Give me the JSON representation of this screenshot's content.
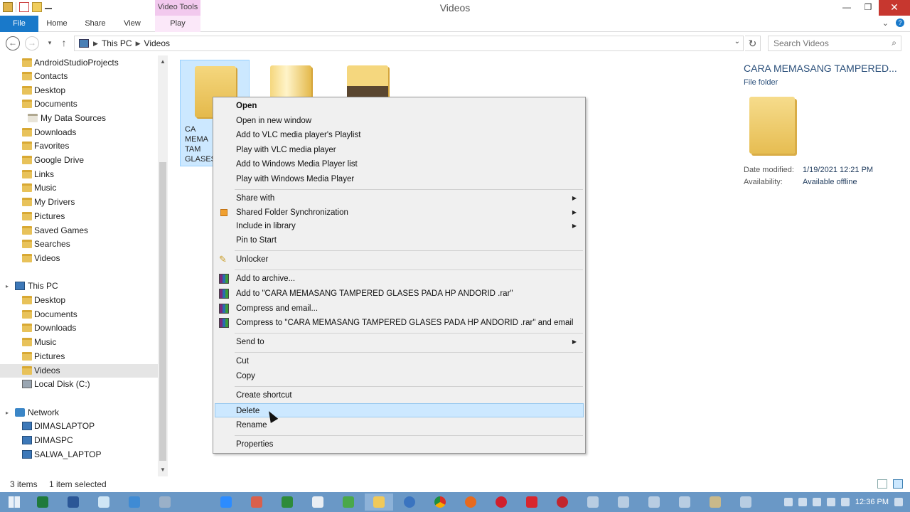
{
  "window": {
    "title": "Videos",
    "context_tab_title": "Video Tools",
    "minimize": "—",
    "maximize": "❐",
    "close": "✕"
  },
  "ribbon": {
    "tabs": [
      {
        "label": "File"
      },
      {
        "label": "Home"
      },
      {
        "label": "Share"
      },
      {
        "label": "View"
      },
      {
        "label": "Play"
      }
    ],
    "expand_icon": "chevron-down-icon",
    "help_icon": "help-icon"
  },
  "address": {
    "crumbs": [
      "This PC",
      "Videos"
    ],
    "search_placeholder": "Search Videos"
  },
  "nav": {
    "favorites_items": [
      "AndroidStudioProjects",
      "Contacts",
      "Desktop",
      "Documents",
      "My Data Sources",
      "Downloads",
      "Favorites",
      "Google Drive",
      "Links",
      "Music",
      "My Drivers",
      "Pictures",
      "Saved Games",
      "Searches",
      "Videos"
    ],
    "this_pc": "This PC",
    "this_pc_items": [
      "Desktop",
      "Documents",
      "Downloads",
      "Music",
      "Pictures",
      "Videos",
      "Local Disk (C:)"
    ],
    "network": "Network",
    "network_items": [
      "DIMASLAPTOP",
      "DIMASPC",
      "SALWA_LAPTOP"
    ]
  },
  "content": {
    "selected_tile_label": "CA\nMEMA\nTAM\nGLASES"
  },
  "details": {
    "title": "CARA MEMASANG TAMPERED...",
    "type": "File folder",
    "date_modified_label": "Date modified:",
    "date_modified_value": "1/19/2021 12:21 PM",
    "availability_label": "Availability:",
    "availability_value": "Available offline"
  },
  "status": {
    "items_count": "3 items",
    "selected": "1 item selected"
  },
  "context_menu": {
    "items": [
      {
        "label": "Open",
        "bold": true
      },
      {
        "label": "Open in new window"
      },
      {
        "label": "Add to VLC media player's Playlist"
      },
      {
        "label": "Play with VLC media player"
      },
      {
        "label": "Add to Windows Media Player list"
      },
      {
        "label": "Play with Windows Media Player"
      },
      {
        "label": "Share with",
        "submenu": true
      },
      {
        "label": "Shared Folder Synchronization",
        "submenu": true,
        "icon": "sync-icon"
      },
      {
        "label": "Include in library",
        "submenu": true
      },
      {
        "label": "Pin to Start"
      },
      {
        "label": "Unlocker",
        "icon": "key-icon"
      },
      {
        "label": "Add to archive...",
        "icon": "winrar-icon"
      },
      {
        "label": "Add to \"CARA MEMASANG TAMPERED GLASES PADA HP ANDORID .rar\"",
        "icon": "winrar-icon"
      },
      {
        "label": "Compress and email...",
        "icon": "winrar-icon"
      },
      {
        "label": "Compress to \"CARA MEMASANG TAMPERED GLASES PADA HP ANDORID .rar\" and email",
        "icon": "winrar-icon"
      },
      {
        "label": "Send to",
        "submenu": true
      },
      {
        "label": "Cut"
      },
      {
        "label": "Copy"
      },
      {
        "label": "Create shortcut"
      },
      {
        "label": "Delete",
        "hover": true
      },
      {
        "label": "Rename"
      },
      {
        "label": "Properties"
      }
    ]
  },
  "taskbar": {
    "clock": "12:36 PM"
  },
  "colors": {
    "accent": "#1979ca",
    "selection": "#cce8ff",
    "taskbar": "#6a98c6",
    "close": "#c7372f"
  }
}
